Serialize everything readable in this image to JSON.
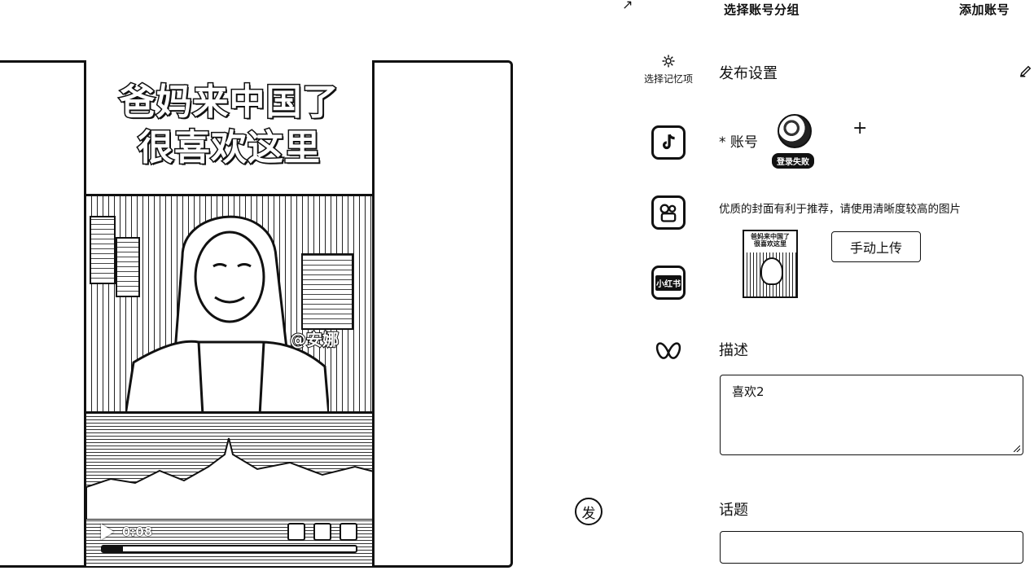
{
  "header": {
    "select_group": "选择账号分组",
    "add_account": "添加账号"
  },
  "video": {
    "title_line1": "爸妈来中国了",
    "title_line2": "很喜欢这里",
    "watermark": "@安娜",
    "current_time": "0:08",
    "progress": 0.08
  },
  "sidebar": {
    "memory_label": "选择记忆项",
    "fa_label": "发",
    "xhs_label": "小红书"
  },
  "settings": {
    "title": "发布设置",
    "account_label": "* 账号",
    "login_failed": "登录失败",
    "cover_hint": "优质的封面有利于推荐，请使用清晰度较高的图片",
    "cover_thumb_text": "爸妈来中国了很喜欢这里",
    "upload_button": "手动上传",
    "description_label": "描述",
    "description_value": "喜欢2",
    "topic_label": "话题",
    "topic_value": ""
  }
}
